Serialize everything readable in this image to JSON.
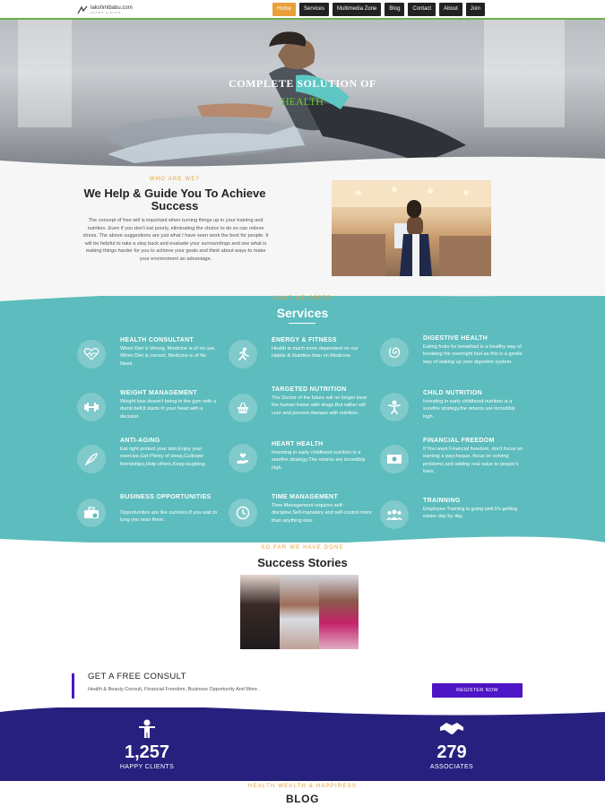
{
  "header": {
    "logo_name": "lakshmibabu.com",
    "logo_tag": "LEARN & EARN",
    "nav": [
      "Home",
      "Services",
      "Multimedia Zone",
      "Blog",
      "Contact",
      "About",
      "Join"
    ],
    "active_nav": "Home",
    "accent": "#e8a13a"
  },
  "hero": {
    "title": "COMPLETE SOLUTION OF",
    "subtitle": "HEALTH",
    "subtitle_color": "#5fd12a"
  },
  "about": {
    "kicker": "WHO ARE WE?",
    "title": "We Help & Guide You To Achieve Success",
    "body": "The concept of free will is important when turning things up in your training and nutrition. Even if you don't eat poorly, eliminating the choice to do so can relieve stress. The above suggestions are just what I have seen work the best for people. It will be helpful to take a step back and evaluate your surroundings and see what is making things harder for you to achieve your goals and think about ways to make your environment an advantage."
  },
  "services": {
    "kicker": "WHAT WE OFFER",
    "title": "Services",
    "bg_color": "#5dbcbd",
    "items": [
      {
        "name": "HEALTH CONSULTANT",
        "icon": "heartbeat-icon",
        "desc": "When Diet is Wrong, Medicine is of no use. When Diet is correct, Medicine is of No Need."
      },
      {
        "name": "ENERGY & FITNESS",
        "icon": "running-icon",
        "desc": "Health is much more dependent on our Habits & Nutrition than on Medicine."
      },
      {
        "name": "DIGESTIVE HEALTH",
        "icon": "digestion-icon",
        "desc": "Eating fruits for breakfast is a healthy way of breaking the overnight fast as this is a gentle way of waking up your digestive system."
      },
      {
        "name": "WEIGHT MANAGEMENT",
        "icon": "dumbbell-icon",
        "desc": "Weight loss doesn't being in the gym with a dumb bell;it starts in your head with a decision."
      },
      {
        "name": "TARGETED NUTRITION",
        "icon": "food-basket-icon",
        "desc": "The Doctor of the future will no longer treat the human frame with drugs,But rather will cure and prevent disease with nutrition."
      },
      {
        "name": "CHILD NUTRITION",
        "icon": "child-icon",
        "desc": "Investing in early childhood nutrition is a surefire strategy.the returns are incredibly high."
      },
      {
        "name": "ANTI-AGING",
        "icon": "feather-icon",
        "desc": "Eat right protect your skin,Enjoy your exercise,Get Plenty of sleep,Cultivate friendships,Help others,Keep laughing."
      },
      {
        "name": "HEART HEALTH",
        "icon": "hand-heart-icon",
        "desc": "Investing in early childhood nutrition is a surefire strategy.The returns are incredibly high."
      },
      {
        "name": "FINANCIAL FREEDOM",
        "icon": "money-icon",
        "desc": "If You want Financial freedom, don't focus on earning a paycheque, focus on solving problems and adding real value to people's lives."
      },
      {
        "name": "BUSINESS OPPORTUNITIES",
        "icon": "briefcase-icon",
        "desc": "Opportunities are like sunrises,If you wait to long you miss them."
      },
      {
        "name": "TIME MANAGEMENT",
        "icon": "clock-icon",
        "desc": "Time Management requires self-discipine,Self-manstery and self-control more than anything else."
      },
      {
        "name": "TRAINNING",
        "icon": "group-icon",
        "desc": "Employee Training is going well.It's getting easier day by day."
      }
    ]
  },
  "success": {
    "kicker": "SO FAR WE HAVE DONE",
    "title": "Success Stories"
  },
  "consult": {
    "title": "GET A FREE CONSULT",
    "subtitle": "Health & Beauty Consult, Financial Freedom, Business Opportunity And More..",
    "button": "REGISTER NOW",
    "color": "#4c15c5"
  },
  "stats": {
    "bg_color": "#27207f",
    "items": [
      {
        "number": "1,257",
        "label": "HAPPY CLIENTS",
        "icon": "person-icon"
      },
      {
        "number": "279",
        "label": "ASSOCIATES",
        "icon": "handshake-icon"
      }
    ]
  },
  "blog": {
    "kicker": "HEALTH WEALTH & HAPPIRESS",
    "title": "BLOG"
  }
}
